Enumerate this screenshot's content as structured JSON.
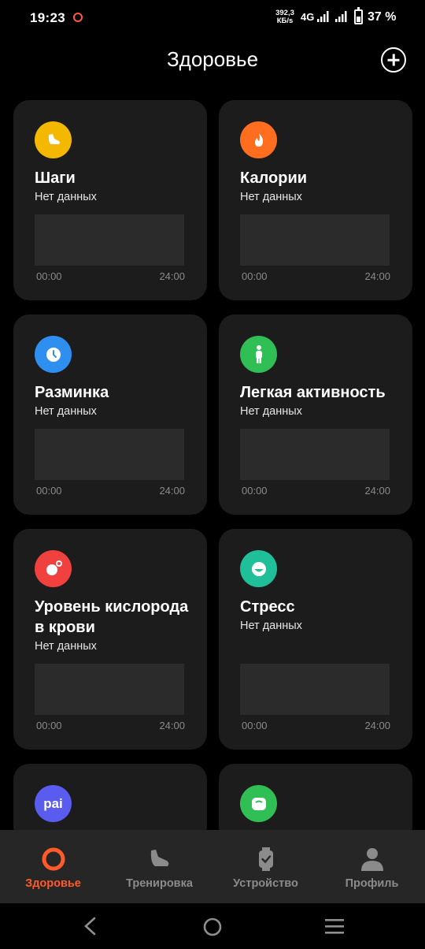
{
  "status_bar": {
    "time": "19:23",
    "net_speed_value": "392,3",
    "net_speed_unit": "КБ/s",
    "network_type": "4G",
    "battery_percent": "37 %"
  },
  "header": {
    "title": "Здоровье"
  },
  "cards": [
    {
      "title": "Шаги",
      "subtitle": "Нет данных",
      "axis_start": "00:00",
      "axis_end": "24:00",
      "icon": "shoe-icon",
      "color": "#f5b800"
    },
    {
      "title": "Калории",
      "subtitle": "Нет данных",
      "axis_start": "00:00",
      "axis_end": "24:00",
      "icon": "flame-icon",
      "color": "#ff6d1f"
    },
    {
      "title": "Разминка",
      "subtitle": "Нет данных",
      "axis_start": "00:00",
      "axis_end": "24:00",
      "icon": "clock-icon",
      "color": "#2f8ff0"
    },
    {
      "title": "Легкая активность",
      "subtitle": "Нет данных",
      "axis_start": "00:00",
      "axis_end": "24:00",
      "icon": "person-icon",
      "color": "#2fbf55"
    },
    {
      "title_line1": "Уровень кислорода",
      "title_line2": "в крови",
      "subtitle": "Нет данных",
      "axis_start": "00:00",
      "axis_end": "24:00",
      "icon": "oxygen-icon",
      "color": "#f0413f"
    },
    {
      "title": "Стресс",
      "subtitle": "Нет данных",
      "axis_start": "00:00",
      "axis_end": "24:00",
      "icon": "stress-face-icon",
      "color": "#1fbf9a"
    },
    {
      "icon_text": "pai",
      "icon": "pai-icon",
      "color": "#5a5cf0"
    },
    {
      "icon": "scale-icon",
      "color": "#2fbf55"
    }
  ],
  "bottom_nav": [
    {
      "label": "Здоровье",
      "icon": "health-ring-icon",
      "active": true
    },
    {
      "label": "Тренировка",
      "icon": "sneaker-icon",
      "active": false
    },
    {
      "label": "Устройство",
      "icon": "watch-icon",
      "active": false
    },
    {
      "label": "Профиль",
      "icon": "profile-icon",
      "active": false
    }
  ],
  "colors": {
    "accent": "#ff5a2a",
    "card_bg": "#1c1c1c",
    "nav_bg": "#262626"
  }
}
